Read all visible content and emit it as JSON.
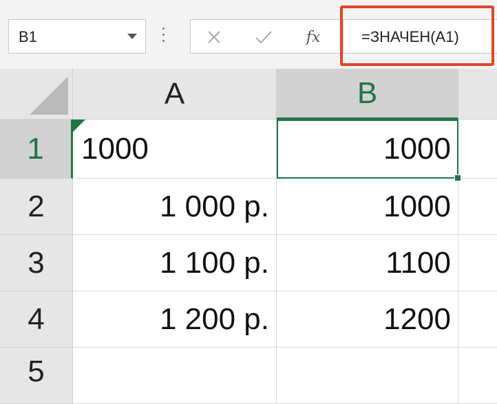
{
  "formula_bar": {
    "name_box": "B1",
    "cancel_icon": "cancel-x-icon",
    "enter_icon": "enter-check-icon",
    "fx_label": "fx",
    "formula": "=ЗНАЧЕН(A1)",
    "highlight_color": "#e0452c"
  },
  "grid": {
    "columns": [
      "A",
      "B"
    ],
    "rows": [
      "1",
      "2",
      "3",
      "4",
      "5"
    ],
    "cells": {
      "A1": "1000",
      "B1": "1000",
      "A2": "1 000 р.",
      "B2": "1000",
      "A3": "1 100 р.",
      "B3": "1100",
      "A4": "1 200 р.",
      "B4": "1200",
      "A5": "",
      "B5": ""
    },
    "selected_cell": "B1",
    "accent_color": "#217346"
  }
}
